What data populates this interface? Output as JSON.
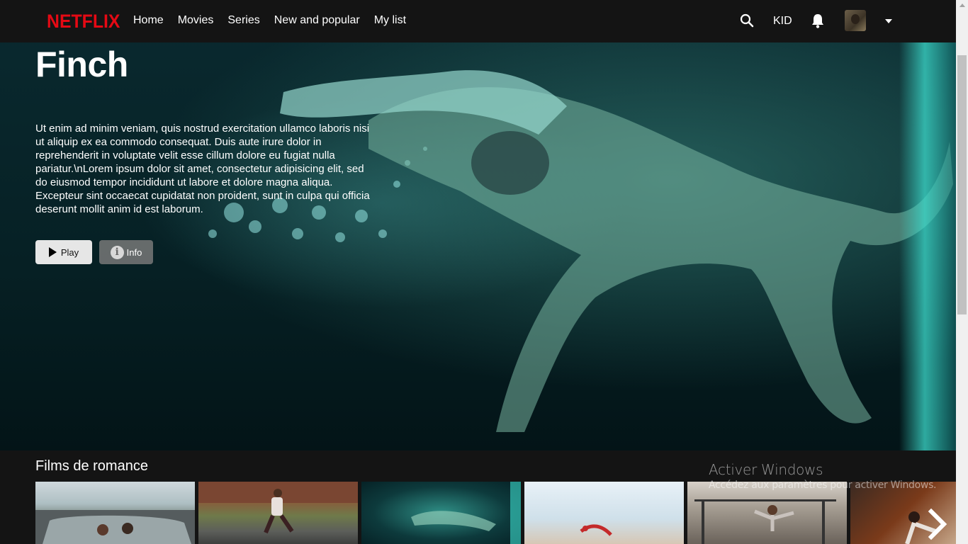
{
  "brand": {
    "logo_text": "NETFLIX",
    "logo_color": "#e50914"
  },
  "nav": {
    "items": [
      {
        "label": "Home"
      },
      {
        "label": "Movies"
      },
      {
        "label": "Series"
      },
      {
        "label": "New and popular"
      },
      {
        "label": "My list"
      }
    ]
  },
  "header_right": {
    "search_icon": "search-icon",
    "profile_label": "KID",
    "bell_icon": "bell-icon",
    "avatar_icon": "avatar",
    "menu_icon": "caret-down-icon"
  },
  "hero": {
    "title": "Finch",
    "description": "Ut enim ad minim veniam, quis nostrud exercitation ullamco laboris nisi ut aliquip ex ea commodo consequat. Duis aute irure dolor in reprehenderit in voluptate velit esse cillum dolore eu fugiat nulla pariatur.\\nLorem ipsum dolor sit amet, consectetur adipisicing elit, sed do eiusmod tempor incididunt ut labore et dolore magna aliqua. Excepteur sint occaecat cupidatat non proident, sunt in culpa qui officia deserunt mollit anim id est laborum.",
    "play_label": "Play",
    "info_label": "Info",
    "info_icon_glyph": "i"
  },
  "row": {
    "title": "Films de romance",
    "next_icon": "chevron-right-icon"
  },
  "watermark": {
    "title": "Activer Windows",
    "subtitle": "Accédez aux paramètres pour activer Windows."
  }
}
